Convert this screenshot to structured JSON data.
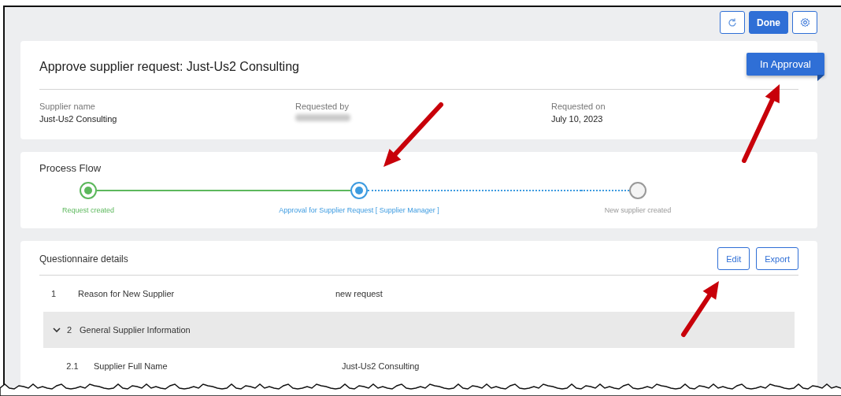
{
  "toolbar": {
    "buttons": [
      {
        "kind": "refresh"
      },
      {
        "kind": "primary",
        "label": "Done"
      },
      {
        "kind": "settings"
      }
    ]
  },
  "header": {
    "title": "Approve supplier request: Just-Us2 Consulting",
    "status": "In Approval",
    "fields": [
      {
        "label": "Supplier name",
        "value": "Just-Us2 Consulting",
        "blurred": false
      },
      {
        "label": "Requested by",
        "blurred": true
      },
      {
        "label": "Requested on",
        "value": "July 10, 2023",
        "blurred": false
      }
    ]
  },
  "process_flow": {
    "title": "Process Flow",
    "steps": [
      {
        "label": "Request created",
        "done": true,
        "current": false
      },
      {
        "label": "Approval for Supplier Request [ Supplier Manager ]",
        "done": false,
        "current": true
      },
      {
        "label": "New supplier created",
        "done": false,
        "current": false
      }
    ]
  },
  "questionnaire": {
    "title": "Questionnaire details",
    "buttons": [
      "Edit",
      "Export"
    ],
    "rows": [
      {
        "kind": "question",
        "number": "1",
        "question": "Reason for New Supplier",
        "answer": "new request"
      },
      {
        "kind": "section",
        "number": "2",
        "question": "General Supplier Information",
        "expanded": true,
        "children": [
          {
            "kind": "question",
            "number": "2.1",
            "question": "Supplier Full Name",
            "answer": "Just-Us2 Consulting"
          }
        ]
      }
    ]
  },
  "annotations": [
    {
      "kind": "arrow"
    },
    {
      "kind": "arrow"
    },
    {
      "kind": "arrow"
    }
  ]
}
